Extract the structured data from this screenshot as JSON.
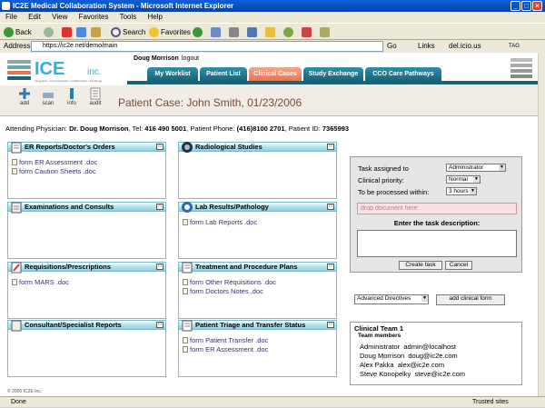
{
  "browser": {
    "title": "IC2E Medical Collaboration System - Microsoft Internet Explorer",
    "menu": [
      "File",
      "Edit",
      "View",
      "Favorites",
      "Tools",
      "Help"
    ],
    "toolbar": {
      "back": "Back",
      "search": "Search",
      "favorites": "Favorites"
    },
    "address_label": "Address",
    "url": "https://ic2e.net/demo/main",
    "go": "Go",
    "links": "Links",
    "delicious": "del.icio.us",
    "tag": "TAG",
    "status": "Done",
    "trusted": "Trusted sites"
  },
  "header": {
    "logo_text": "ICE",
    "logo_sub": "inc.",
    "logo_tagline": "Integration • Communication • Collaboration • Exchange",
    "user": "Doug Morrison",
    "logout": "logout",
    "tabs": [
      "My Worklist",
      "Patient List",
      "Clinical Cases",
      "Study Exchange",
      "CCO Care Pathways"
    ],
    "active_tab": "Clinical Cases"
  },
  "actions": [
    {
      "label": "add"
    },
    {
      "label": "scan"
    },
    {
      "label": "info"
    },
    {
      "label": "audit"
    }
  ],
  "case": {
    "title": "Patient Case: John Smith, 01/23/2006",
    "attending_label": "Attending Physician:",
    "physician": "Dr. Doug Morrison",
    "tel_label": ", Tel:",
    "tel": "416 490 5001",
    "phone_label": ", Patient Phone:",
    "phone": "(416)8100 2701",
    "id_label": ", Patient ID:",
    "id": "7365993"
  },
  "panels": [
    {
      "title": "ER Reports/Doctor's Orders",
      "docs": [
        "form ER Assessment .doc",
        "form Caution Sheets .doc"
      ]
    },
    {
      "title": "Radiological Studies",
      "docs": []
    },
    {
      "title": "Examinations and Consults",
      "docs": []
    },
    {
      "title": "Lab Results/Pathology",
      "docs": [
        "form Lab Reports .doc"
      ]
    },
    {
      "title": "Requisitions/Prescriptions",
      "docs": [
        "form MARS .doc"
      ]
    },
    {
      "title": "Treatment and Procedure Plans",
      "docs": [
        "form Other Requisitions .doc",
        "form Doctors Notes .doc"
      ]
    },
    {
      "title": "Consultant/Specialist Reports",
      "docs": []
    },
    {
      "title": "Patient Triage and Transfer Status",
      "docs": [
        "form Patient Transfer .doc",
        "form ER Assessment .doc"
      ]
    }
  ],
  "task": {
    "assigned_label": "Task assigned to",
    "assigned_value": "Administrator",
    "priority_label": "Clinical priority:",
    "priority_value": "Normal",
    "within_label": "To be processed within:",
    "within_value": "3 hours",
    "drop": "drop document here",
    "desc_label": "Enter the task description:",
    "create": "Create task",
    "cancel": "Cancel"
  },
  "advanced": {
    "select_value": "Advanced Directives",
    "button": "add clinical form"
  },
  "team": {
    "title": "Clinical Team 1",
    "subtitle": "Team members",
    "members": [
      {
        "name": "Administrator",
        "email": "admin@localhost"
      },
      {
        "name": "Doug Morrison",
        "email": "doug@ic2e.com"
      },
      {
        "name": "Alex Pakka",
        "email": "alex@ic2e.com"
      },
      {
        "name": "Steve Konopelky",
        "email": "steve@ic2e.com"
      }
    ]
  },
  "footer": "© 2005 IC2E Inc.",
  "colors": {
    "teal": "#1b6278",
    "orange": "#e8744f",
    "title_brown": "#7a4a35"
  }
}
